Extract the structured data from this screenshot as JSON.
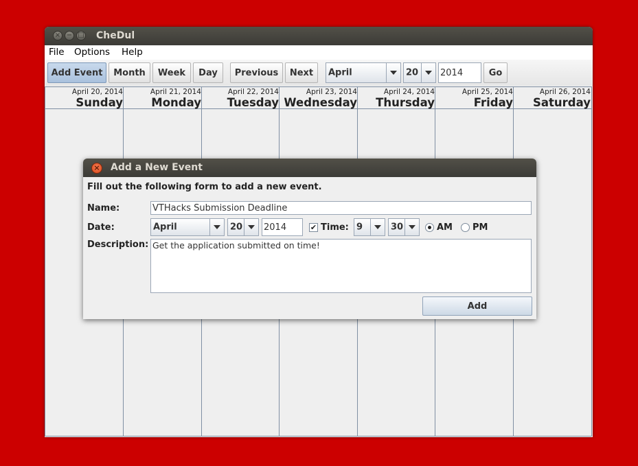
{
  "window": {
    "title": "CheDul"
  },
  "menu": {
    "items": [
      "File",
      "Options",
      "Help"
    ]
  },
  "toolbar": {
    "add_event": "Add Event",
    "month": "Month",
    "week": "Week",
    "day": "Day",
    "previous": "Previous",
    "next": "Next",
    "month_select": "April",
    "day_select": "20",
    "year_input": "2014",
    "go": "Go"
  },
  "calendar": {
    "days": [
      {
        "date": "April 20, 2014",
        "name": "Sunday"
      },
      {
        "date": "April 21, 2014",
        "name": "Monday"
      },
      {
        "date": "April 22, 2014",
        "name": "Tuesday"
      },
      {
        "date": "April 23, 2014",
        "name": "Wednesday"
      },
      {
        "date": "April 24, 2014",
        "name": "Thursday"
      },
      {
        "date": "April 25, 2014",
        "name": "Friday"
      },
      {
        "date": "April 26, 2014",
        "name": "Saturday"
      }
    ]
  },
  "dialog": {
    "title": "Add a New Event",
    "instructions": "Fill out the following form to add a new event.",
    "name_label": "Name:",
    "name_value": "VTHacks Submission Deadline",
    "date_label": "Date:",
    "month": "April",
    "day": "20",
    "year": "2014",
    "time_checked": true,
    "time_label": "Time:",
    "hour": "9",
    "minute": "30",
    "am_label": "AM",
    "pm_label": "PM",
    "am_selected": true,
    "description_label": "Description:",
    "description_value": "Get the application submitted on time!",
    "add_button": "Add"
  },
  "colors": {
    "desktop": "#cc0000",
    "titlebar": "#3c3b37",
    "active_button": "#b8cde6",
    "grid_lines": "#7f8fa3"
  }
}
